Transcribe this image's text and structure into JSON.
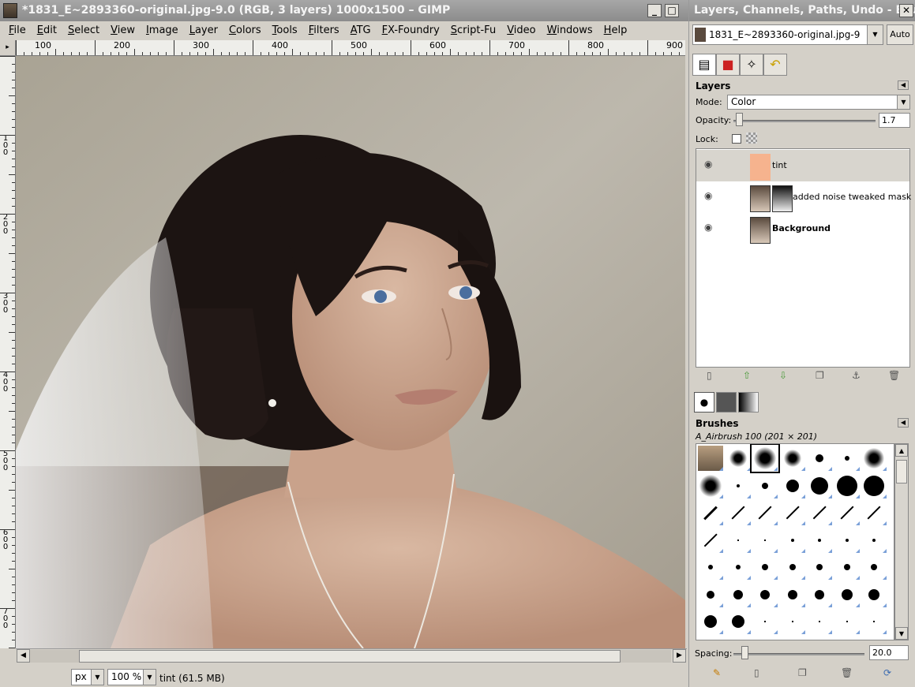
{
  "image_window": {
    "title": "*1831_E~2893360-original.jpg-9.0 (RGB, 3 layers) 1000x1500 – GIMP",
    "menu": [
      "File",
      "Edit",
      "Select",
      "View",
      "Image",
      "Layer",
      "Colors",
      "Tools",
      "Filters",
      "ATG",
      "FX-Foundry",
      "Script-Fu",
      "Video",
      "Windows",
      "Help"
    ],
    "ruler_h_labels": [
      "100",
      "200",
      "300",
      "400",
      "500",
      "600",
      "700",
      "800",
      "900"
    ],
    "ruler_v_labels": [
      "1 0 0",
      "2 0 0",
      "3 0 0",
      "4 0 0",
      "5 0 0",
      "6 0 0",
      "7 0 0"
    ],
    "status": {
      "unit": "px",
      "zoom": "100 %",
      "info": "tint (61.5 MB)"
    },
    "window_buttons": {
      "minimize": "_",
      "maximize": "□",
      "close": "✕"
    }
  },
  "dock": {
    "title": "Layers, Channels, Paths, Undo - Bru...",
    "image_selector": "1831_E~2893360-original.jpg-9",
    "auto_label": "Auto",
    "layers": {
      "title": "Layers",
      "mode_label": "Mode:",
      "mode_value": "Color",
      "opacity_label": "Opacity:",
      "opacity_value": "1.7",
      "opacity_fraction": 0.017,
      "lock_label": "Lock:",
      "items": [
        {
          "name": "tint",
          "thumb_color": "#f6b38e",
          "bold": false
        },
        {
          "name": "added noise tweaked mask",
          "bold": false
        },
        {
          "name": "Background",
          "bold": true
        }
      ]
    },
    "brushes": {
      "title": "Brushes",
      "current": "A_Airbrush 100 (201 × 201)",
      "spacing_label": "Spacing:",
      "spacing_value": "20.0"
    }
  },
  "colors": {
    "title_bar": "#979797",
    "tint_layer": "#f6b38e",
    "canvas_bg": "#b4afa4"
  }
}
